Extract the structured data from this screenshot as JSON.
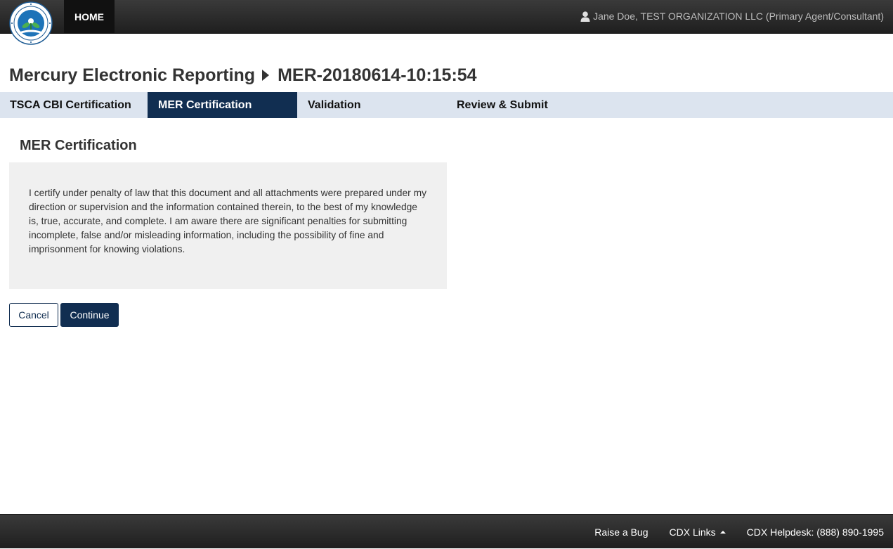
{
  "colors": {
    "topbar": "#2b2b2b",
    "home_active": "#111111",
    "navy": "#112e51",
    "steps_bg": "#dce4ef",
    "cert_box_bg": "#f0f0f0"
  },
  "header": {
    "logo_icon": "epa-seal-logo",
    "home_label": "HOME",
    "user_icon": "user-icon",
    "user_text": "Jane Doe, TEST ORGANIZATION LLC (Primary Agent/Consultant)"
  },
  "breadcrumb": {
    "app_title": "Mercury Electronic Reporting",
    "separator_icon": "caret-right-icon",
    "submission_id": "MER-20180614-10:15:54"
  },
  "steps": [
    {
      "label": "TSCA CBI Certification",
      "active": false
    },
    {
      "label": "MER Certification",
      "active": true
    },
    {
      "label": "Validation",
      "active": false
    },
    {
      "label": "Review & Submit",
      "active": false
    }
  ],
  "section": {
    "title": "MER Certification",
    "certification_text": "I certify under penalty of law that this document and all attachments were prepared under my direction or supervision and the information contained therein, to the best of my knowledge is, true, accurate, and complete. I am aware there are significant penalties for submitting incomplete, false and/or misleading information, including the possibility of fine and imprisonment for knowing violations."
  },
  "actions": {
    "cancel_label": "Cancel",
    "continue_label": "Continue"
  },
  "footer": {
    "raise_bug": "Raise a Bug",
    "cdx_links": "CDX Links",
    "cdx_links_icon": "caret-up-icon",
    "helpdesk": "CDX Helpdesk: (888) 890-1995"
  }
}
